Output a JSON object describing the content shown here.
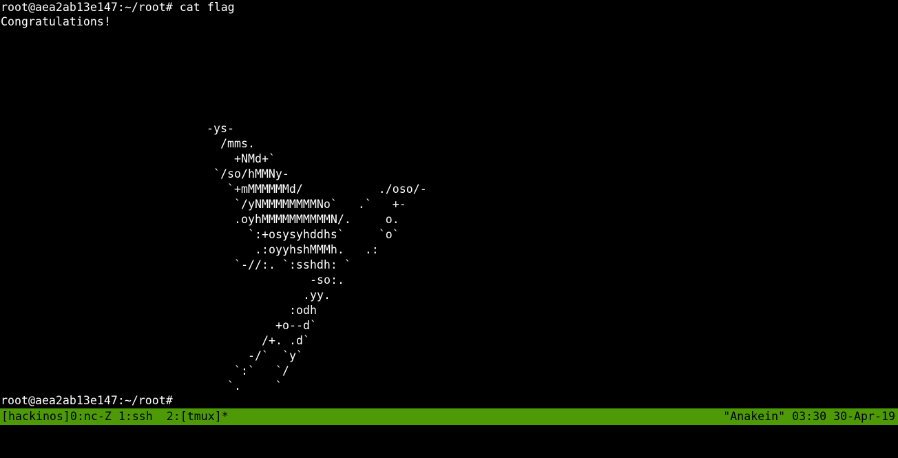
{
  "terminal": {
    "command_line": "root@aea2ab13e147:~/root# cat flag",
    "output_line": "Congratulations!",
    "art": [
      "-ys-",
      "/mms.",
      "+NMd+`",
      "`/so/hMMNy-",
      "`+mMMMMMMd/           ./oso/-",
      "`/yNMMMMMMMMNo`   .`   +-",
      ".oyhMMMMMMMMMMN/.     o.",
      "`:+osysyhddhs`     `o`",
      ".:oyyhshMMMh.   .:",
      "`-//:. `:sshdh: `",
      "-so:.",
      ".yy.",
      ":odh",
      "+o--d`",
      "/+. .d`",
      "-/`  `y`",
      "`:`   `/",
      "`.     `"
    ],
    "prompt_line": "root@aea2ab13e147:~/root#"
  },
  "statusbar": {
    "left": "[hackinos]0:nc-Z 1:ssh  2:[tmux]*",
    "right": "\"Anakein\" 03:30 30-Apr-19"
  },
  "colors": {
    "background": "#000000",
    "foreground": "#ffffff",
    "statusbar_bg": "#4e9a06",
    "statusbar_fg": "#000000"
  }
}
